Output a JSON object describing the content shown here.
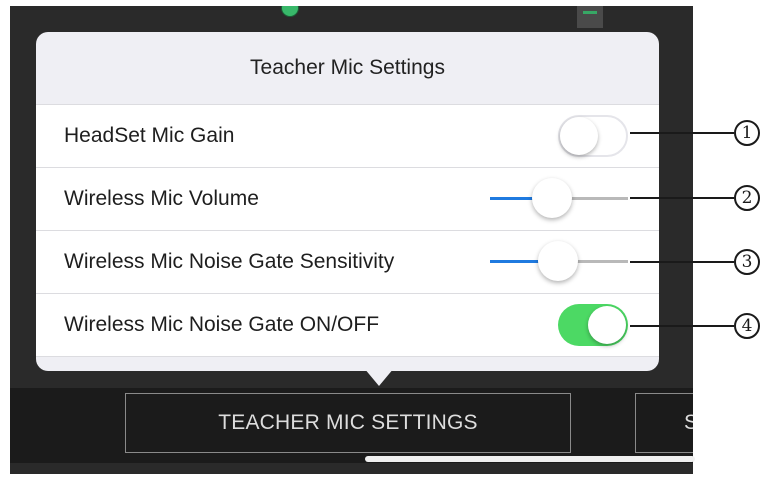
{
  "popover": {
    "title": "Teacher Mic Settings",
    "rows": [
      {
        "label": "HeadSet Mic Gain",
        "control": "switch",
        "on": false
      },
      {
        "label": "Wireless Mic  Volume",
        "control": "slider",
        "value": 0.45
      },
      {
        "label": "Wireless Mic Noise Gate Sensitivity",
        "control": "slider",
        "value": 0.49
      },
      {
        "label": "Wireless Mic Noise Gate ON/OFF",
        "control": "switch",
        "on": true
      }
    ]
  },
  "tabbar": {
    "teacher_mic_label": "TEACHER MIC SETTINGS",
    "second_label": "S"
  },
  "callouts": [
    "1",
    "2",
    "3",
    "4"
  ],
  "colors": {
    "switch_on": "#4cd964",
    "slider_fill": "#1f7ae0",
    "app_background": "#2a2a2a"
  }
}
